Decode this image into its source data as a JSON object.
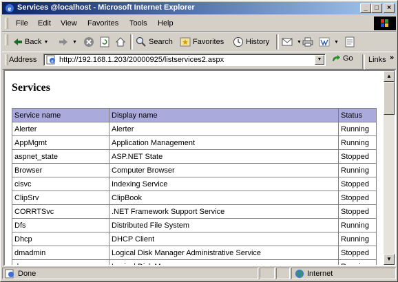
{
  "window": {
    "title": "Services @localhost - Microsoft Internet Explorer"
  },
  "menu": [
    "File",
    "Edit",
    "View",
    "Favorites",
    "Tools",
    "Help"
  ],
  "toolbar": {
    "back": "Back",
    "search": "Search",
    "favorites": "Favorites",
    "history": "History"
  },
  "address": {
    "label": "Address",
    "url": "http://192.168.1.203/20000925/listservices2.aspx",
    "go": "Go",
    "links": "Links"
  },
  "page": {
    "heading": "Services",
    "columns": [
      "Service name",
      "Display name",
      "Status"
    ],
    "rows": [
      [
        "Alerter",
        "Alerter",
        "Running"
      ],
      [
        "AppMgmt",
        "Application Management",
        "Running"
      ],
      [
        "aspnet_state",
        "ASP.NET State",
        "Stopped"
      ],
      [
        "Browser",
        "Computer Browser",
        "Running"
      ],
      [
        "cisvc",
        "Indexing Service",
        "Stopped"
      ],
      [
        "ClipSrv",
        "ClipBook",
        "Stopped"
      ],
      [
        "CORRTSvc",
        ".NET Framework Support Service",
        "Stopped"
      ],
      [
        "Dfs",
        "Distributed File System",
        "Running"
      ],
      [
        "Dhcp",
        "DHCP Client",
        "Running"
      ],
      [
        "dmadmin",
        "Logical Disk Manager Administrative Service",
        "Stopped"
      ],
      [
        "dmserver",
        "Logical Disk Manager",
        "Running"
      ]
    ]
  },
  "status": {
    "left": "Done",
    "zone": "Internet"
  },
  "colors": {
    "title_start": "#0a246a",
    "title_end": "#a6caf0",
    "header_row": "#aaaadd",
    "chrome": "#d4d0c8"
  }
}
